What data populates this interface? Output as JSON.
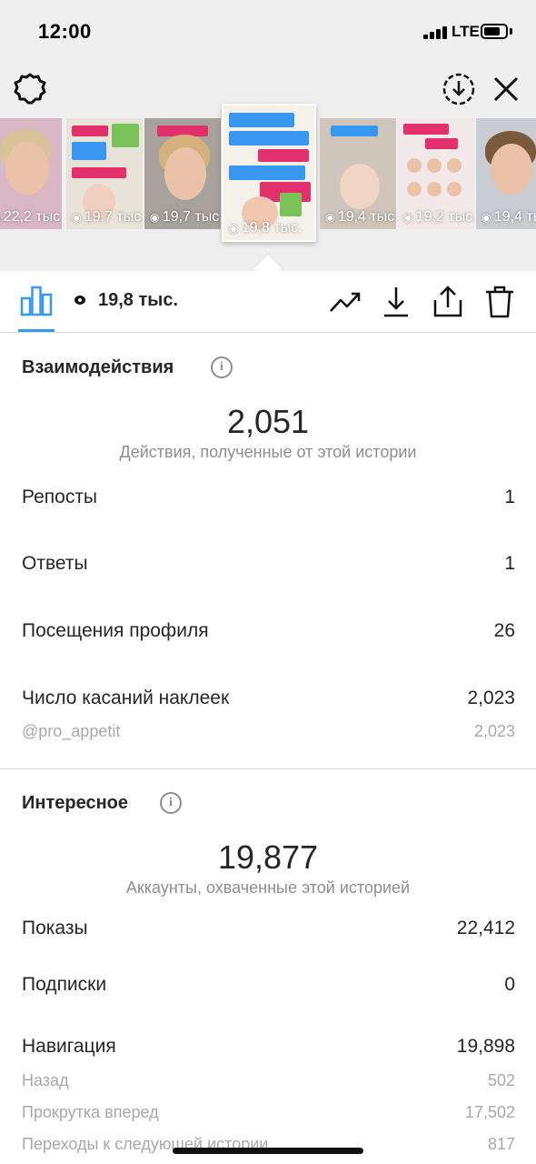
{
  "status_bar": {
    "time": "12:00",
    "network": "LTE"
  },
  "stories": [
    {
      "views": "22,2 тыс.",
      "bg": "#d9b7c4"
    },
    {
      "views": "19,7 тыс.",
      "bg": "#e8e3d8"
    },
    {
      "views": "19,7 тыс.",
      "bg": "#a8a29c"
    },
    {
      "views": "19,8 тыс.",
      "bg": "#f4f1ea",
      "selected": true
    },
    {
      "views": "19,4 тыс.",
      "bg": "#cfc5ba"
    },
    {
      "views": "19,2 тыс.",
      "bg": "#f2e8ea"
    },
    {
      "views": "19,4 тыс.",
      "bg": "#c9cdd2"
    }
  ],
  "selected_story_stickers": {
    "q1": "Как понять, что еда попадает в желудок?",
    "q2": "Почему после родов тянет на сладкое?",
    "mention": "@pro_appetit",
    "q3": "Что нельзя есть при кормлении грудью?",
    "q4": "Пост, который сохранят все кормящие мамы"
  },
  "toolbar": {
    "views": "19,8 тыс."
  },
  "interactions": {
    "title": "Взаимодействия",
    "total": "2,051",
    "caption": "Действия, полученные от этой истории",
    "rows": [
      {
        "label": "Репосты",
        "value": "1"
      },
      {
        "label": "Ответы",
        "value": "1"
      },
      {
        "label": "Посещения профиля",
        "value": "26"
      },
      {
        "label": "Число касаний наклеек",
        "value": "2,023"
      }
    ],
    "sub_rows": [
      {
        "label": "@pro_appetit",
        "value": "2,023"
      }
    ]
  },
  "discovery": {
    "title": "Интересное",
    "total": "19,877",
    "caption": "Аккаунты, охваченные этой историей",
    "rows": [
      {
        "label": "Показы",
        "value": "22,412"
      },
      {
        "label": "Подписки",
        "value": "0"
      },
      {
        "label": "Навигация",
        "value": "19,898"
      }
    ],
    "sub_rows": [
      {
        "label": "Назад",
        "value": "502"
      },
      {
        "label": "Прокрутка вперед",
        "value": "17,502"
      },
      {
        "label": "Переходы к следующей истории",
        "value": "817"
      }
    ]
  },
  "colors": {
    "accent": "#3897f0",
    "text": "#262626",
    "muted": "#8e8e8e",
    "top_bg": "#efefef"
  }
}
